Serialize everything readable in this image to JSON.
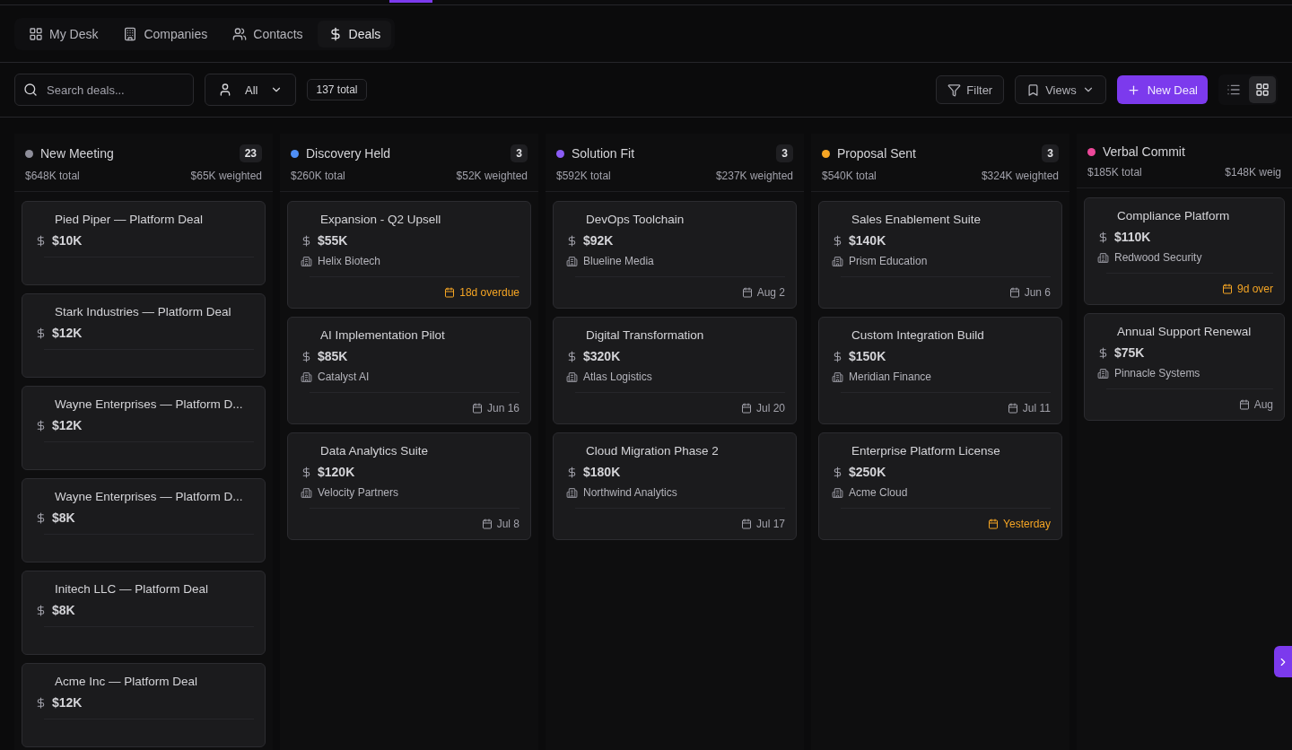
{
  "nav_tabs": [
    {
      "kind": "desk",
      "label": "My Desk",
      "selected": false
    },
    {
      "kind": "companies",
      "label": "Companies",
      "selected": false
    },
    {
      "kind": "contacts",
      "label": "Contacts",
      "selected": false
    },
    {
      "kind": "deals",
      "label": "Deals",
      "selected": true
    }
  ],
  "toolbar": {
    "search": {
      "placeholder": "Search deals..."
    },
    "owner_filter": {
      "value": "All"
    },
    "total": "137 total",
    "filter_button": "Filter",
    "views_button": "Views",
    "new_button": "New Deal",
    "view_modes": [
      {
        "kind": "list",
        "selected": false
      },
      {
        "kind": "grid",
        "selected": true
      }
    ]
  },
  "columns": [
    {
      "name": "New Meeting",
      "color": "#8e8e9a",
      "count": "23",
      "total": "$648K total",
      "weighted": "$65K weighted",
      "cards": [
        {
          "title": "Pied Piper — Platform Deal",
          "amount": "$10K"
        },
        {
          "title": "Stark Industries — Platform Deal",
          "amount": "$12K"
        },
        {
          "title": "Wayne Enterprises — Platform D...",
          "amount": "$12K"
        },
        {
          "title": "Wayne Enterprises — Platform D...",
          "amount": "$8K"
        },
        {
          "title": "Initech LLC — Platform Deal",
          "amount": "$8K"
        },
        {
          "title": "Acme Inc — Platform Deal",
          "amount": "$12K"
        }
      ]
    },
    {
      "name": "Discovery Held",
      "color": "#4f8ff7",
      "count": "3",
      "total": "$260K total",
      "weighted": "$52K weighted",
      "cards": [
        {
          "title": "Expansion - Q2 Upsell",
          "amount": "$55K",
          "company": "Helix Biotech",
          "date": "18d overdue",
          "overdue": true
        },
        {
          "title": "AI Implementation Pilot",
          "amount": "$85K",
          "company": "Catalyst AI",
          "date": "Jun 16",
          "overdue": false
        },
        {
          "title": "Data Analytics Suite",
          "amount": "$120K",
          "company": "Velocity Partners",
          "date": "Jul 8",
          "overdue": false
        }
      ]
    },
    {
      "name": "Solution Fit",
      "color": "#8b5cf6",
      "count": "3",
      "total": "$592K total",
      "weighted": "$237K weighted",
      "cards": [
        {
          "title": "DevOps Toolchain",
          "amount": "$92K",
          "company": "Blueline Media",
          "date": "Aug 2",
          "overdue": false
        },
        {
          "title": "Digital Transformation",
          "amount": "$320K",
          "company": "Atlas Logistics",
          "date": "Jul 20",
          "overdue": false
        },
        {
          "title": "Cloud Migration Phase 2",
          "amount": "$180K",
          "company": "Northwind Analytics",
          "date": "Jul 17",
          "overdue": false
        }
      ]
    },
    {
      "name": "Proposal Sent",
      "color": "#f5a524",
      "count": "3",
      "total": "$540K total",
      "weighted": "$324K weighted",
      "cards": [
        {
          "title": "Sales Enablement Suite",
          "amount": "$140K",
          "company": "Prism Education",
          "date": "Jun 6",
          "overdue": false
        },
        {
          "title": "Custom Integration Build",
          "amount": "$150K",
          "company": "Meridian Finance",
          "date": "Jul 11",
          "overdue": false
        },
        {
          "title": "Enterprise Platform License",
          "amount": "$250K",
          "company": "Acme Cloud",
          "date": "Yesterday",
          "overdue": true
        }
      ]
    },
    {
      "name": "Verbal Commit",
      "color": "#ec4899",
      "total": "$185K total",
      "weighted": "$148K weig",
      "cards": [
        {
          "title": "Compliance Platform",
          "amount": "$110K",
          "company": "Redwood Security",
          "date": "9d over",
          "overdue": true
        },
        {
          "title": "Annual Support Renewal",
          "amount": "$75K",
          "company": "Pinnacle Systems",
          "date": "Aug",
          "overdue": false
        }
      ]
    }
  ]
}
